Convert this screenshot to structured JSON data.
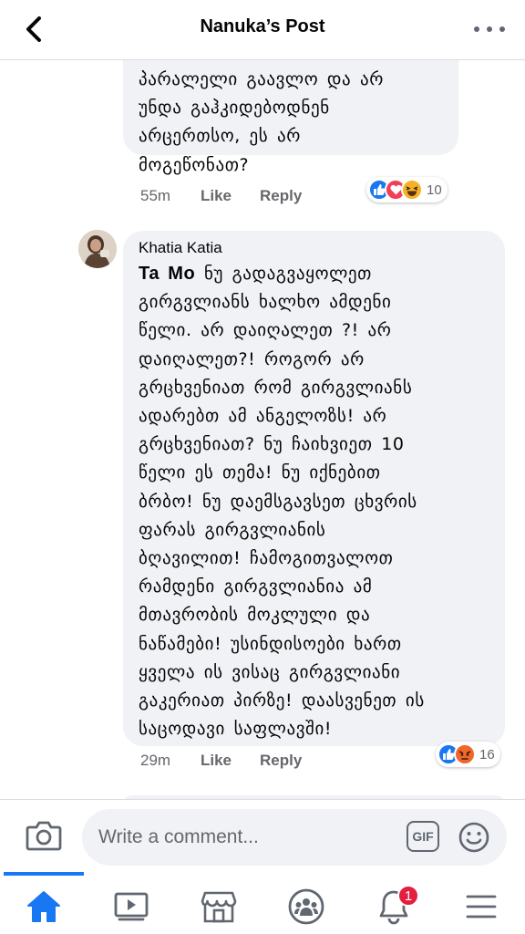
{
  "header": {
    "title": "Nanuka’s Post"
  },
  "comments": [
    {
      "text_lines": [
        "პარალელი გაავლო და არ",
        "უნდა გაჰკიდებოდნენ",
        "არცერთსო, ეს არ",
        "მოგეწონათ?"
      ],
      "time": "55m",
      "like_label": "Like",
      "reply_label": "Reply",
      "reaction_count": "10",
      "reactions": [
        "like-icon",
        "love-icon",
        "haha-icon"
      ]
    },
    {
      "author": "Khatia Katia",
      "tag": "Ta Mo",
      "first_line_rest": "ნუ გადაგვაყოლეთ",
      "text_lines": [
        "გირგვლიანს ხალხო ამდენი",
        "წელი. არ დაიღალეთ ?! არ",
        "დაიღალეთ?!  როგორ არ",
        "გრცხვენიათ რომ გირგვლიანს",
        "ადარებთ ამ ანგელოზს! არ",
        "გრცხვენიათ?  ნუ ჩაიხვიეთ 10",
        "წელი ეს თემა!  ნუ იქნებით",
        "ბრბო! ნუ დაემსგავსეთ ცხვრის",
        "ფარას  გირგვლიანის",
        "ბღავილით! ჩამოგითვალოთ",
        "რამდენი გირგვლიანია ამ",
        "მთავრობის მოკლული და",
        "ნაწამები! უსინდისოები ხართ",
        "ყველა ის ვისაც გირგვლიანი",
        "გაკერიათ პირზე! დაასვენეთ ის",
        "საცოდავი საფლავში!"
      ],
      "time": "29m",
      "like_label": "Like",
      "reply_label": "Reply",
      "reaction_count": "16",
      "reactions": [
        "like-icon",
        "angry-icon"
      ]
    }
  ],
  "composer": {
    "placeholder": "Write a comment...",
    "gif_label": "GIF"
  },
  "tabs": [
    {
      "name": "home",
      "active": true
    },
    {
      "name": "watch"
    },
    {
      "name": "marketplace"
    },
    {
      "name": "groups"
    },
    {
      "name": "notifications",
      "badge": "1"
    },
    {
      "name": "menu"
    }
  ],
  "colors": {
    "accent": "#1877f2",
    "bubble": "#f0f2f5",
    "meta": "#65676b",
    "badge": "#e41e3f",
    "angry": "#f0672a",
    "love": "#f33e58",
    "haha": "#f7b125"
  }
}
